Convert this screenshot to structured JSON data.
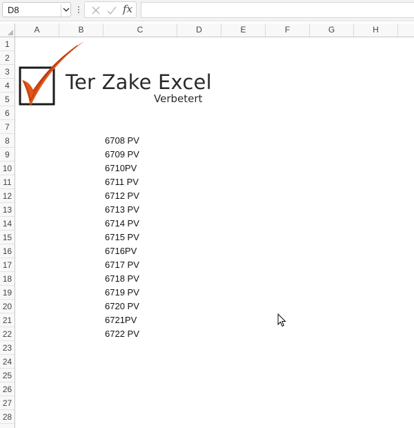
{
  "formula_bar": {
    "name_box": "D8",
    "formula": "",
    "fx_label": "fx"
  },
  "columns": [
    "A",
    "B",
    "C",
    "D",
    "E",
    "F",
    "G",
    "H"
  ],
  "rows": [
    "1",
    "2",
    "3",
    "4",
    "5",
    "6",
    "7",
    "8",
    "9",
    "10",
    "11",
    "12",
    "13",
    "14",
    "15",
    "16",
    "17",
    "18",
    "19",
    "20",
    "21",
    "22",
    "23",
    "24",
    "25",
    "26",
    "27",
    "28"
  ],
  "logo": {
    "title": "Ter Zake Excel",
    "subtitle": "Verbetert",
    "colors": {
      "check": "#e0561c",
      "box": "#1a1a1a",
      "text": "#2a2a2a"
    }
  },
  "cells": {
    "column": "C",
    "items": [
      {
        "row": "8",
        "value": "6708 PV"
      },
      {
        "row": "9",
        "value": "6709 PV"
      },
      {
        "row": "10",
        "value": "6710PV"
      },
      {
        "row": "11",
        "value": "6711 PV"
      },
      {
        "row": "12",
        "value": "6712 PV"
      },
      {
        "row": "13",
        "value": "6713 PV"
      },
      {
        "row": "14",
        "value": "6714 PV"
      },
      {
        "row": "15",
        "value": "6715 PV"
      },
      {
        "row": "16",
        "value": "6716PV"
      },
      {
        "row": "17",
        "value": "6717 PV"
      },
      {
        "row": "18",
        "value": "6718 PV"
      },
      {
        "row": "19",
        "value": "6719 PV"
      },
      {
        "row": "20",
        "value": "6720 PV"
      },
      {
        "row": "21",
        "value": "6721PV"
      },
      {
        "row": "22",
        "value": "6722 PV"
      }
    ]
  }
}
